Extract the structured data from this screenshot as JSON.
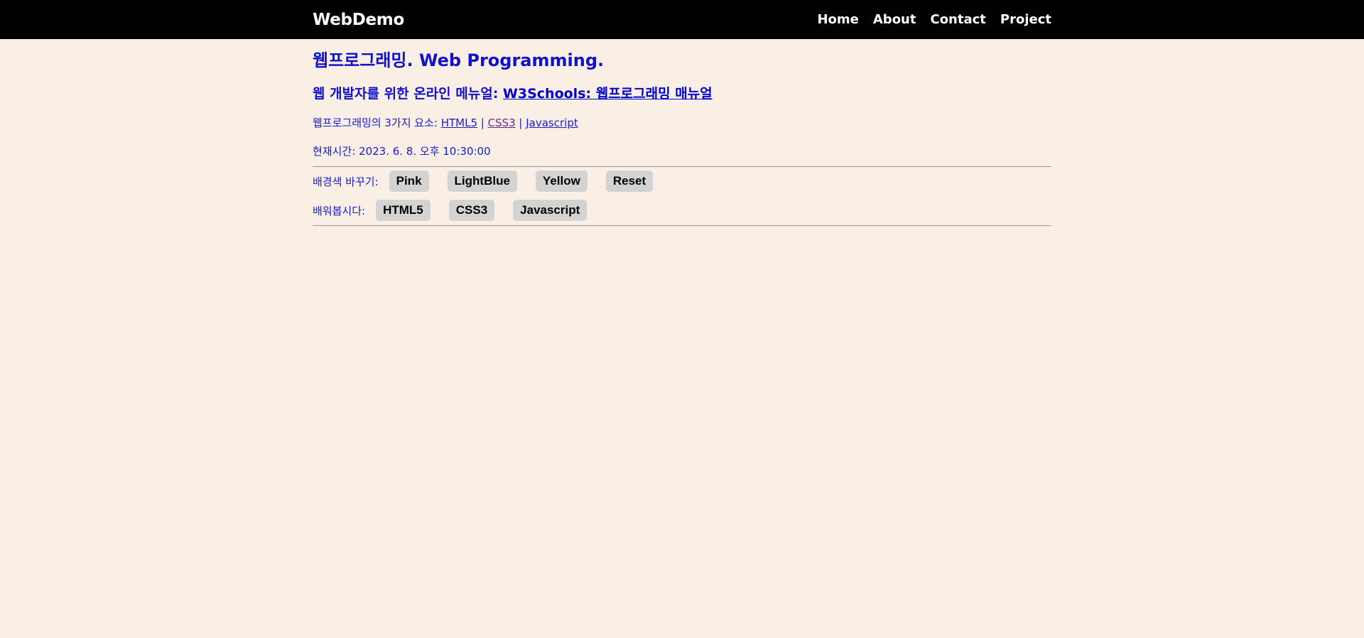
{
  "nav": {
    "brand": "WebDemo",
    "links": [
      "Home",
      "About",
      "Contact",
      "Project"
    ]
  },
  "main": {
    "title": "웹프로그래밍. Web Programming.",
    "manual_prefix": "웹 개발자를 위한 온라인 메뉴얼: ",
    "manual_link": "W3Schools: 웹프로그래밍 매뉴얼",
    "elements_prefix": "웹프로그래밍의 3가지 요소: ",
    "element_links": [
      "HTML5",
      "CSS3",
      "Javascript"
    ],
    "separator": " | ",
    "time_text": "현재시간: 2023. 6. 8. 오후 10:30:00",
    "bg_label": "배경색 바꾸기:",
    "bg_buttons": [
      "Pink",
      "LightBlue",
      "Yellow",
      "Reset"
    ],
    "learn_label": "배워봅시다:",
    "learn_buttons": [
      "HTML5",
      "CSS3",
      "Javascript"
    ]
  },
  "colors": {
    "background": "#faefe4",
    "navbar": "#000000",
    "text": "#1a1ad6",
    "button": "#d3d3d3",
    "visited_link": "#6b2a8c"
  }
}
